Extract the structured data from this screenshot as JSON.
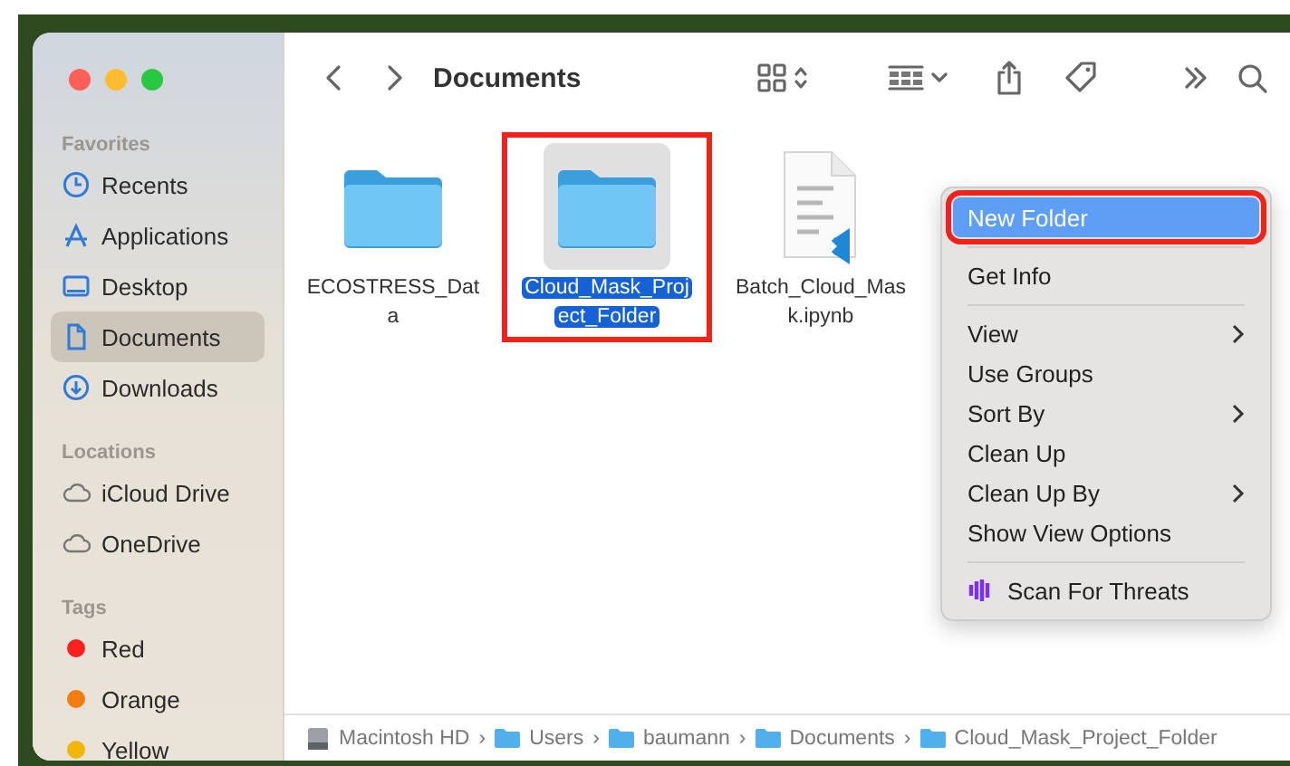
{
  "toolbar": {
    "title": "Documents"
  },
  "sidebar": [
    {
      "heading": "Favorites",
      "items": [
        {
          "label": "Recents",
          "kind": "clock",
          "selected": false
        },
        {
          "label": "Applications",
          "kind": "apps",
          "selected": false
        },
        {
          "label": "Desktop",
          "kind": "desktop",
          "selected": false
        },
        {
          "label": "Documents",
          "kind": "document",
          "selected": true
        },
        {
          "label": "Downloads",
          "kind": "download",
          "selected": false
        }
      ]
    },
    {
      "heading": "Locations",
      "items": [
        {
          "label": "iCloud Drive",
          "kind": "cloud",
          "selected": false
        },
        {
          "label": "OneDrive",
          "kind": "cloud",
          "selected": false
        }
      ]
    },
    {
      "heading": "Tags",
      "items": [
        {
          "label": "Red",
          "kind": "tag",
          "color": "#fe1f1f",
          "selected": false
        },
        {
          "label": "Orange",
          "kind": "tag",
          "color": "#f57c0f",
          "selected": false
        },
        {
          "label": "Yellow",
          "kind": "tag",
          "color": "#f2b705",
          "selected": false
        }
      ]
    }
  ],
  "files": [
    {
      "name_lines": [
        "ECOSTRESS_Dat",
        "a"
      ],
      "kind": "folder",
      "selected": false,
      "annotated": false
    },
    {
      "name_lines": [
        "Cloud_Mask_Proj",
        "ect_Folder"
      ],
      "kind": "folder",
      "selected": true,
      "annotated": true
    },
    {
      "name_lines": [
        "Batch_Cloud_Mas",
        "k.ipynb"
      ],
      "kind": "notebook",
      "selected": false,
      "annotated": false
    }
  ],
  "context_menu": [
    {
      "kind": "item",
      "label": "New Folder",
      "submenu": false,
      "highlighted": true,
      "annotated": true
    },
    {
      "kind": "separator"
    },
    {
      "kind": "item",
      "label": "Get Info",
      "submenu": false,
      "highlighted": false,
      "annotated": false
    },
    {
      "kind": "separator"
    },
    {
      "kind": "item",
      "label": "View",
      "submenu": true,
      "highlighted": false,
      "annotated": false
    },
    {
      "kind": "item",
      "label": "Use Groups",
      "submenu": false,
      "highlighted": false,
      "annotated": false
    },
    {
      "kind": "item",
      "label": "Sort By",
      "submenu": true,
      "highlighted": false,
      "annotated": false
    },
    {
      "kind": "item",
      "label": "Clean Up",
      "submenu": false,
      "highlighted": false,
      "annotated": false
    },
    {
      "kind": "item",
      "label": "Clean Up By",
      "submenu": true,
      "highlighted": false,
      "annotated": false
    },
    {
      "kind": "item",
      "label": "Show View Options",
      "submenu": false,
      "highlighted": false,
      "annotated": false
    },
    {
      "kind": "separator"
    },
    {
      "kind": "extension",
      "label": "Scan For Threats",
      "submenu": false,
      "highlighted": false,
      "annotated": false
    }
  ],
  "path_bar": {
    "separator": "›",
    "items": [
      {
        "label": "Macintosh HD",
        "kind": "disk"
      },
      {
        "label": "Users",
        "kind": "folder"
      },
      {
        "label": "baumann",
        "kind": "folder"
      },
      {
        "label": "Documents",
        "kind": "folder"
      },
      {
        "label": "Cloud_Mask_Project_Folder",
        "kind": "folder"
      }
    ]
  }
}
